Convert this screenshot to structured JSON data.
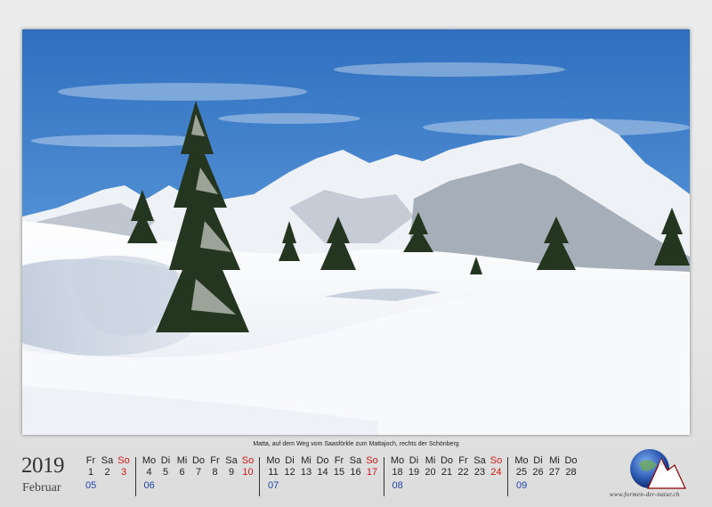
{
  "photo": {
    "description_icon": "winter-mountain-photo",
    "sky_color": "#3a7bc8",
    "snow_color": "#f4f6fa"
  },
  "caption": "Matta, auf dem Weg vom Saasförkle zum Mattajoch, rechts der Schönberg",
  "calendar": {
    "year": "2019",
    "month": "Februar",
    "weeks": [
      {
        "kw": "05",
        "days": [
          {
            "n": "Fr",
            "d": "1",
            "sun": false
          },
          {
            "n": "Sa",
            "d": "2",
            "sun": false
          },
          {
            "n": "So",
            "d": "3",
            "sun": true
          }
        ]
      },
      {
        "kw": "06",
        "days": [
          {
            "n": "Mo",
            "d": "4",
            "sun": false
          },
          {
            "n": "Di",
            "d": "5",
            "sun": false
          },
          {
            "n": "Mi",
            "d": "6",
            "sun": false
          },
          {
            "n": "Do",
            "d": "7",
            "sun": false
          },
          {
            "n": "Fr",
            "d": "8",
            "sun": false
          },
          {
            "n": "Sa",
            "d": "9",
            "sun": false
          },
          {
            "n": "So",
            "d": "10",
            "sun": true
          }
        ]
      },
      {
        "kw": "07",
        "days": [
          {
            "n": "Mo",
            "d": "11",
            "sun": false
          },
          {
            "n": "Di",
            "d": "12",
            "sun": false
          },
          {
            "n": "Mi",
            "d": "13",
            "sun": false
          },
          {
            "n": "Do",
            "d": "14",
            "sun": false
          },
          {
            "n": "Fr",
            "d": "15",
            "sun": false
          },
          {
            "n": "Sa",
            "d": "16",
            "sun": false
          },
          {
            "n": "So",
            "d": "17",
            "sun": true
          }
        ]
      },
      {
        "kw": "08",
        "days": [
          {
            "n": "Mo",
            "d": "18",
            "sun": false
          },
          {
            "n": "Di",
            "d": "19",
            "sun": false
          },
          {
            "n": "Mi",
            "d": "20",
            "sun": false
          },
          {
            "n": "Do",
            "d": "21",
            "sun": false
          },
          {
            "n": "Fr",
            "d": "22",
            "sun": false
          },
          {
            "n": "Sa",
            "d": "23",
            "sun": false
          },
          {
            "n": "So",
            "d": "24",
            "sun": true
          }
        ]
      },
      {
        "kw": "09",
        "days": [
          {
            "n": "Mo",
            "d": "25",
            "sun": false
          },
          {
            "n": "Di",
            "d": "26",
            "sun": false
          },
          {
            "n": "Mi",
            "d": "27",
            "sun": false
          },
          {
            "n": "Do",
            "d": "28",
            "sun": false
          }
        ]
      }
    ],
    "sunday_color": "#d01818",
    "week_number_color": "#2244aa"
  },
  "logo": {
    "icon": "globe-mountain-logo-icon",
    "text": "www.formen-der-natur.ch"
  }
}
